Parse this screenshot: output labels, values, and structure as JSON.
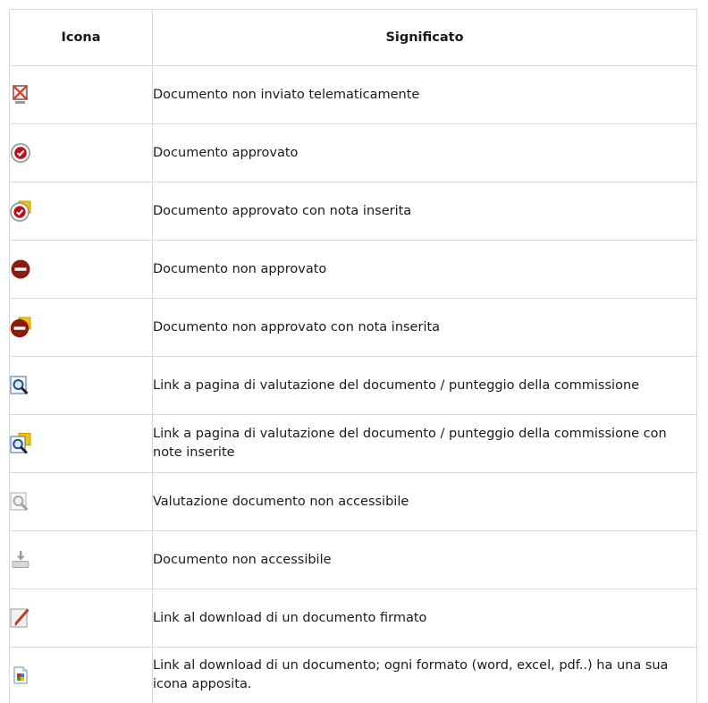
{
  "headers": {
    "icon": "Icona",
    "meaning": "Significato"
  },
  "rows": [
    {
      "icon": "not-sent-monitor-icon",
      "label": "Documento non inviato telematicamente"
    },
    {
      "icon": "approved-check-icon",
      "label": "Documento approvato"
    },
    {
      "icon": "approved-with-note-icon",
      "label": "Documento approvato con nota inserita"
    },
    {
      "icon": "not-approved-icon",
      "label": "Documento non approvato"
    },
    {
      "icon": "not-approved-with-note-icon",
      "label": "Documento non approvato con nota inserita"
    },
    {
      "icon": "magnifier-icon",
      "label": "Link a pagina di valutazione del documento / punteggio della commissione"
    },
    {
      "icon": "magnifier-with-note-icon",
      "label": "Link a pagina di valutazione del documento / punteggio della commissione con note inserite"
    },
    {
      "icon": "magnifier-disabled-icon",
      "label": "Valutazione documento non accessibile"
    },
    {
      "icon": "download-disabled-icon",
      "label": "Documento non accessibile"
    },
    {
      "icon": "signed-document-pen-icon",
      "label": "Link al download di un documento firmato"
    },
    {
      "icon": "generic-file-icon",
      "label": "Link al download di un documento; ogni formato (word, excel, pdf..) ha una sua icona apposita."
    }
  ],
  "colors": {
    "border": "#d9d9d9",
    "dark_red": "#8b1a12",
    "check_red": "#b5121b",
    "note_yellow": "#f5c400"
  }
}
